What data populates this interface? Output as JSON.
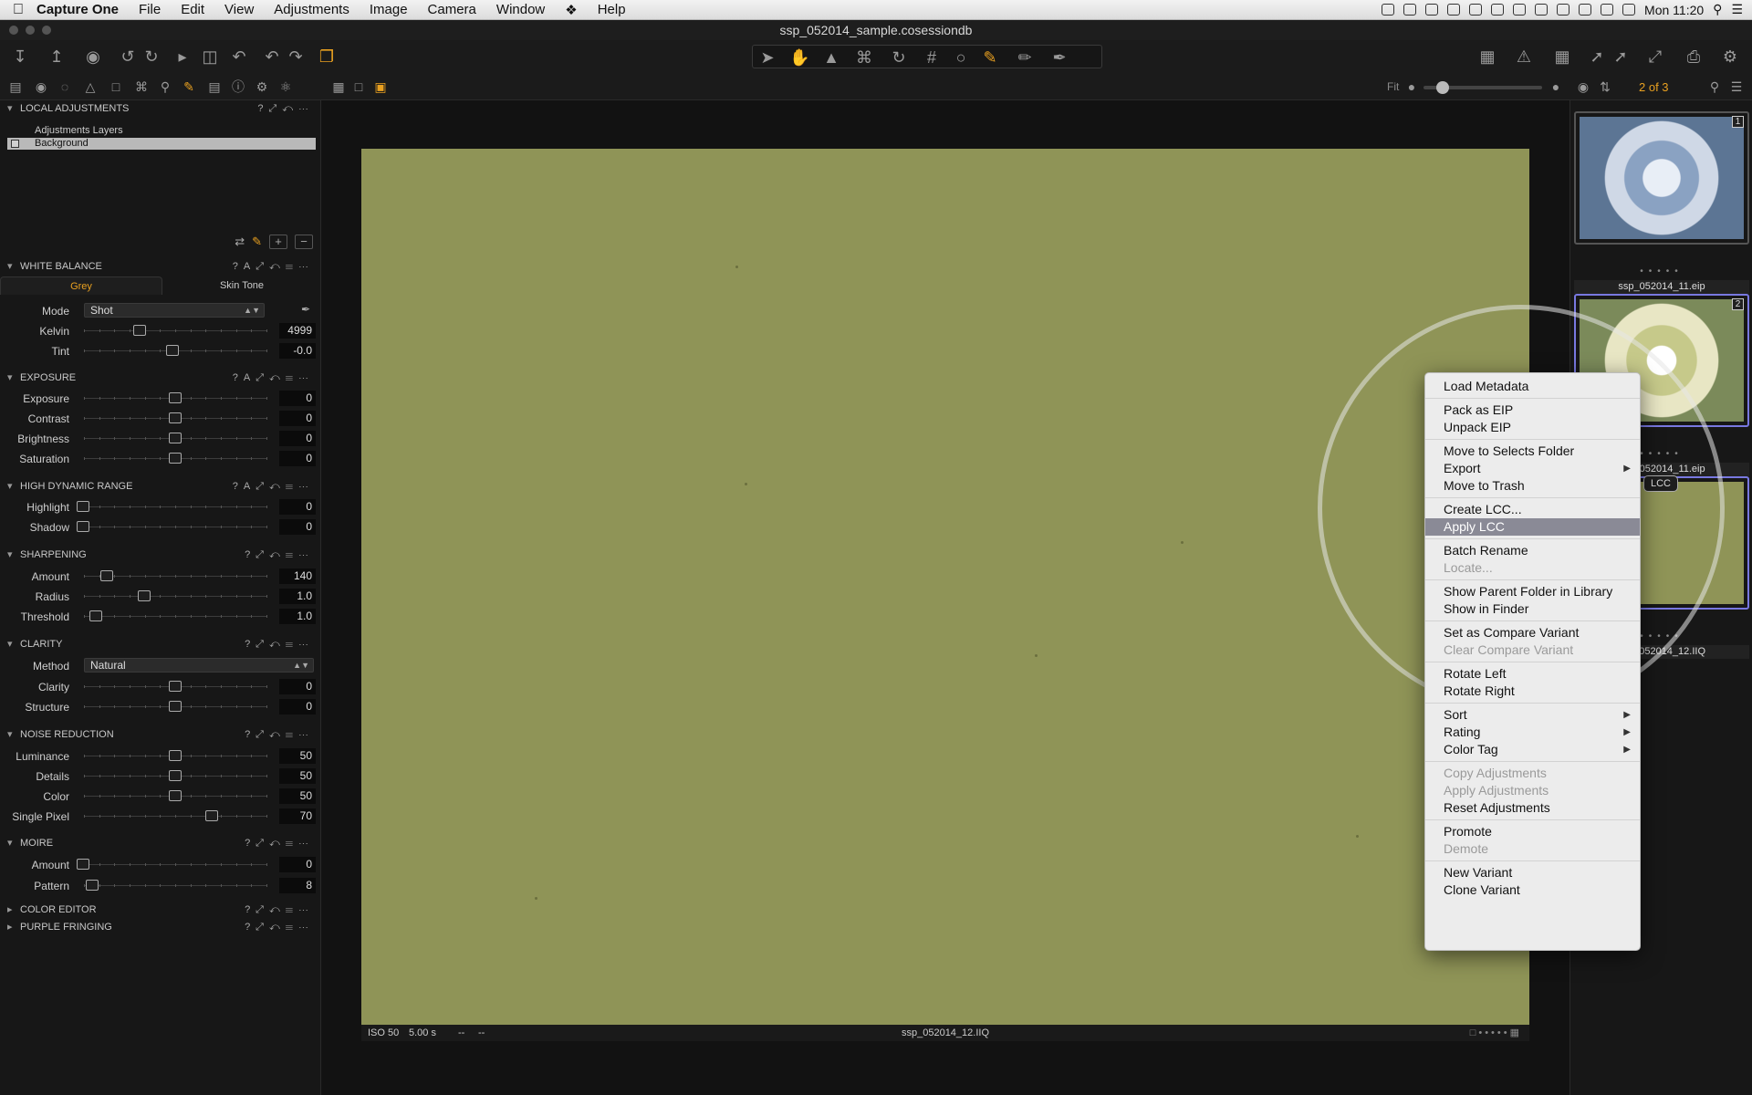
{
  "menubar": {
    "apple": "",
    "app_name": "Capture One",
    "items": [
      "File",
      "Edit",
      "View",
      "Adjustments",
      "Image",
      "Camera",
      "Window",
      "Help"
    ],
    "clock": "Mon 11:20"
  },
  "window": {
    "title": "ssp_052014_sample.cosessiondb"
  },
  "viewer_controls": {
    "fit_label": "Fit",
    "counter": "2 of 3"
  },
  "local_adjustments": {
    "title": "LOCAL ADJUSTMENTS",
    "layers_title": "Adjustments Layers",
    "layer_name": "Background"
  },
  "white_balance": {
    "title": "WHITE BALANCE",
    "tabs": [
      "Grey",
      "Skin Tone"
    ],
    "mode_label": "Mode",
    "mode_value": "Shot",
    "kelvin_label": "Kelvin",
    "kelvin_value": "4999",
    "tint_label": "Tint",
    "tint_value": "-0.0"
  },
  "exposure": {
    "title": "EXPOSURE",
    "rows": [
      {
        "label": "Exposure",
        "value": "0"
      },
      {
        "label": "Contrast",
        "value": "0"
      },
      {
        "label": "Brightness",
        "value": "0"
      },
      {
        "label": "Saturation",
        "value": "0"
      }
    ]
  },
  "hdr": {
    "title": "HIGH DYNAMIC RANGE",
    "rows": [
      {
        "label": "Highlight",
        "value": "0"
      },
      {
        "label": "Shadow",
        "value": "0"
      }
    ]
  },
  "sharpening": {
    "title": "SHARPENING",
    "rows": [
      {
        "label": "Amount",
        "value": "140"
      },
      {
        "label": "Radius",
        "value": "1.0"
      },
      {
        "label": "Threshold",
        "value": "1.0"
      }
    ]
  },
  "clarity": {
    "title": "CLARITY",
    "method_label": "Method",
    "method_value": "Natural",
    "rows": [
      {
        "label": "Clarity",
        "value": "0"
      },
      {
        "label": "Structure",
        "value": "0"
      }
    ]
  },
  "noise_reduction": {
    "title": "NOISE REDUCTION",
    "rows": [
      {
        "label": "Luminance",
        "value": "50"
      },
      {
        "label": "Details",
        "value": "50"
      },
      {
        "label": "Color",
        "value": "50"
      },
      {
        "label": "Single Pixel",
        "value": "70"
      }
    ]
  },
  "moire": {
    "title": "MOIRE",
    "rows": [
      {
        "label": "Amount",
        "value": "0"
      },
      {
        "label": "Pattern",
        "value": "8"
      }
    ]
  },
  "color_editor": {
    "title": "COLOR EDITOR"
  },
  "purple_fringing": {
    "title": "PURPLE FRINGING"
  },
  "viewer": {
    "iso": "ISO 50",
    "shutter": "5.00 s",
    "aperture": "--",
    "focal": "--",
    "filename": "ssp_052014_12.IIQ"
  },
  "browser": {
    "thumbs": [
      {
        "badge": "1",
        "name": "ssp_052014_11.eip"
      },
      {
        "badge": "2",
        "name": "ssp_052014_11.eip"
      },
      {
        "badge": "",
        "name": "ssp_052014_12.IIQ"
      }
    ],
    "lcc_badge": "LCC"
  },
  "context_menu": {
    "groups": [
      [
        {
          "label": "Load Metadata",
          "enabled": true
        }
      ],
      [
        {
          "label": "Pack as EIP",
          "enabled": true
        },
        {
          "label": "Unpack EIP",
          "enabled": true
        }
      ],
      [
        {
          "label": "Move to Selects Folder",
          "enabled": true
        },
        {
          "label": "Export",
          "enabled": true,
          "submenu": true
        },
        {
          "label": "Move to Trash",
          "enabled": true
        }
      ],
      [
        {
          "label": "Create LCC...",
          "enabled": true
        },
        {
          "label": "Apply LCC",
          "enabled": true,
          "highlighted": true
        }
      ],
      [
        {
          "label": "Batch Rename",
          "enabled": true
        },
        {
          "label": "Locate...",
          "enabled": false
        }
      ],
      [
        {
          "label": "Show Parent Folder in Library",
          "enabled": true
        },
        {
          "label": "Show in Finder",
          "enabled": true
        }
      ],
      [
        {
          "label": "Set as Compare Variant",
          "enabled": true
        },
        {
          "label": "Clear Compare Variant",
          "enabled": false
        }
      ],
      [
        {
          "label": "Rotate Left",
          "enabled": true
        },
        {
          "label": "Rotate Right",
          "enabled": true
        }
      ],
      [
        {
          "label": "Sort",
          "enabled": true,
          "submenu": true
        },
        {
          "label": "Rating",
          "enabled": true,
          "submenu": true
        },
        {
          "label": "Color Tag",
          "enabled": true,
          "submenu": true
        }
      ],
      [
        {
          "label": "Copy Adjustments",
          "enabled": false
        },
        {
          "label": "Apply Adjustments",
          "enabled": false
        },
        {
          "label": "Reset Adjustments",
          "enabled": true
        }
      ],
      [
        {
          "label": "Promote",
          "enabled": true
        },
        {
          "label": "Demote",
          "enabled": false
        }
      ],
      [
        {
          "label": "New Variant",
          "enabled": true
        },
        {
          "label": "Clone Variant",
          "enabled": true
        }
      ]
    ]
  },
  "colors": {
    "accent": "#e8a020",
    "photo": "#8f9457",
    "menu_highlight": "#8a8a96"
  }
}
